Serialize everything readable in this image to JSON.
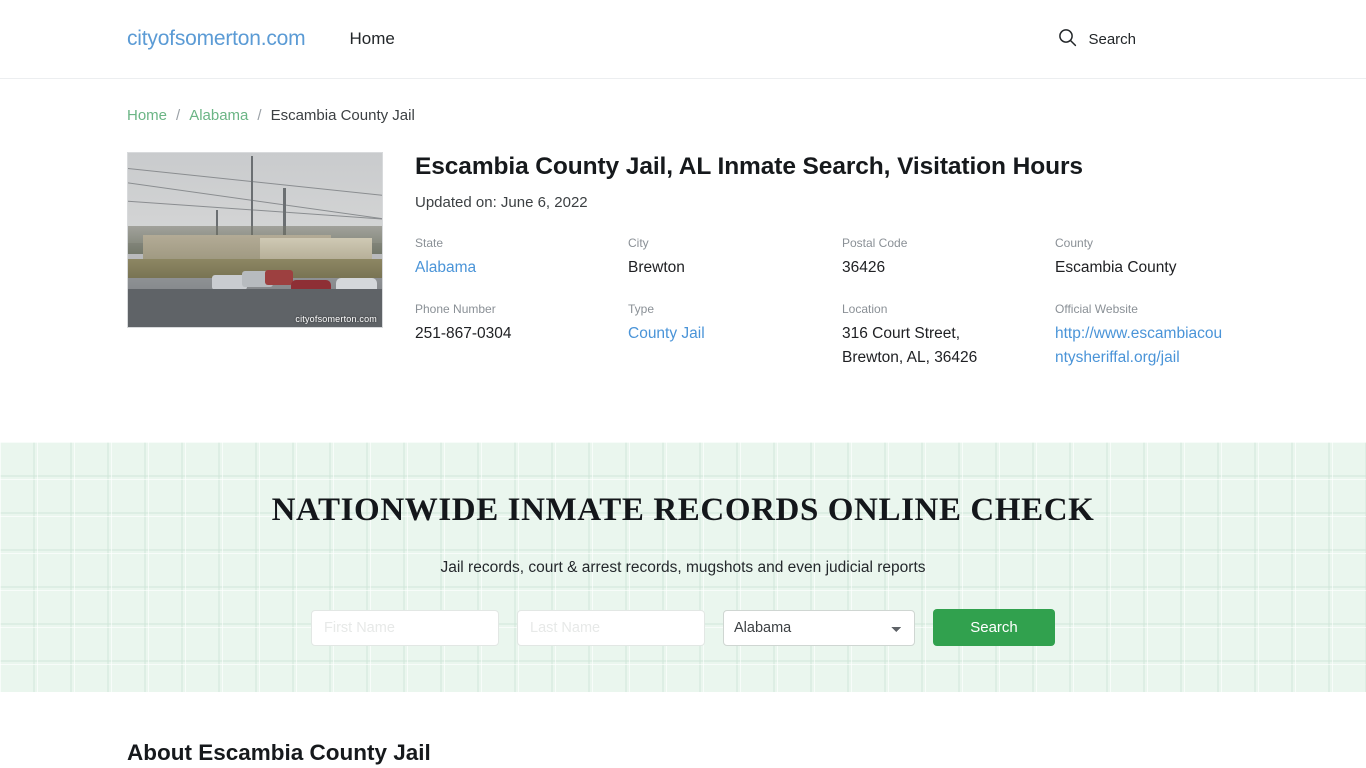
{
  "header": {
    "brand": "cityofsomerton.com",
    "nav": [
      {
        "label": "Home"
      }
    ],
    "search_label": "Search",
    "search_icon": "search-icon"
  },
  "breadcrumb": {
    "items": [
      {
        "label": "Home",
        "link": true
      },
      {
        "label": "Alabama",
        "link": true
      },
      {
        "label": "Escambia County Jail",
        "link": false
      }
    ],
    "separator": "/"
  },
  "article": {
    "title": "Escambia County Jail, AL Inmate Search, Visitation Hours",
    "updated": "Updated on: June 6, 2022",
    "image_watermark": "cityofsomerton.com",
    "facts": [
      {
        "label": "State",
        "value": "Alabama",
        "link": true
      },
      {
        "label": "City",
        "value": "Brewton",
        "link": false
      },
      {
        "label": "Postal Code",
        "value": "36426",
        "link": false
      },
      {
        "label": "County",
        "value": "Escambia County",
        "link": false
      },
      {
        "label": "Phone Number",
        "value": "251-867-0304",
        "link": false
      },
      {
        "label": "Type",
        "value": "County Jail",
        "link": true
      },
      {
        "label": "Location",
        "value": "316 Court Street, Brewton, AL, 36426",
        "link": false
      },
      {
        "label": "Official Website",
        "value": "http://www.escambiacountysheriffal.org/jail",
        "link": true
      }
    ]
  },
  "promo": {
    "heading": "Nationwide Inmate Records Online Check",
    "subheading": "Jail records, court & arrest records, mugshots and even judicial reports",
    "first_name_placeholder": "First Name",
    "first_name_value": "",
    "last_name_placeholder": "Last Name",
    "last_name_value": "",
    "state_selected": "Alabama",
    "state_options": [
      "Alabama"
    ],
    "submit_label": "Search",
    "accent_color": "#31a14e",
    "background_color": "#eaf6ee"
  },
  "about": {
    "heading": "About Escambia County Jail"
  }
}
